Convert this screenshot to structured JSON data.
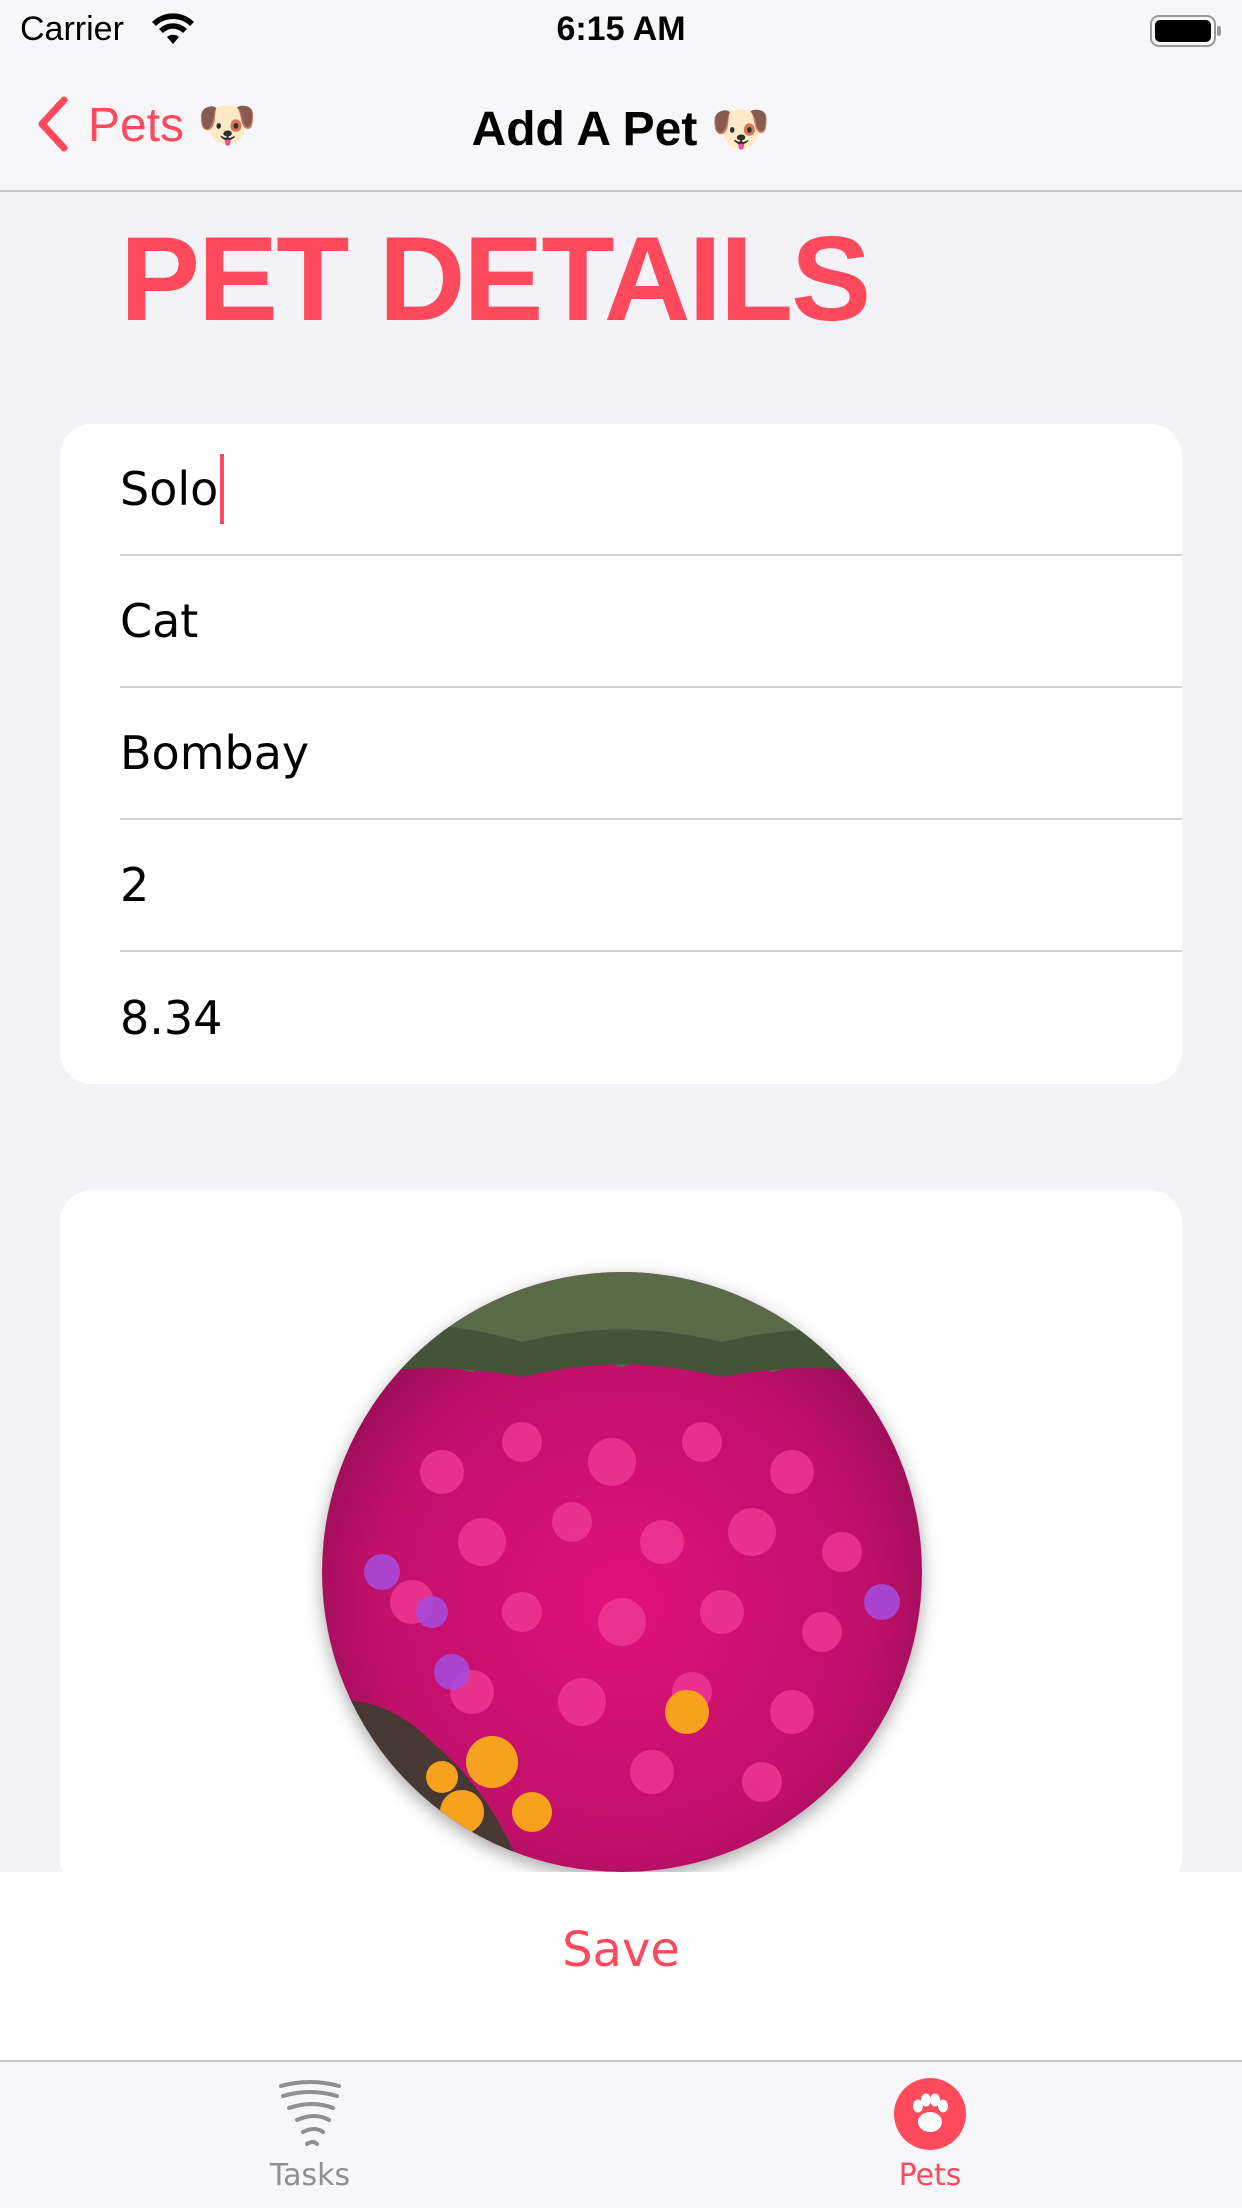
{
  "status_bar": {
    "carrier": "Carrier",
    "time": "6:15 AM"
  },
  "nav": {
    "back_label": "Pets 🐶",
    "title": "Add A Pet 🐶"
  },
  "section": {
    "title": "PET DETAILS"
  },
  "form": {
    "fields": [
      {
        "value": "Solo"
      },
      {
        "value": "Cat"
      },
      {
        "value": "Bombay"
      },
      {
        "value": "2"
      },
      {
        "value": "8.34"
      }
    ]
  },
  "photo": {
    "subject": "pink flowers"
  },
  "save": {
    "label": "Save"
  },
  "tabs": [
    {
      "label": "Tasks",
      "icon": "tornado-icon"
    },
    {
      "label": "Pets",
      "icon": "paw-icon"
    }
  ],
  "colors": {
    "accent": "#ff4a5e",
    "background": "#f2f2f7",
    "card": "#ffffff"
  }
}
